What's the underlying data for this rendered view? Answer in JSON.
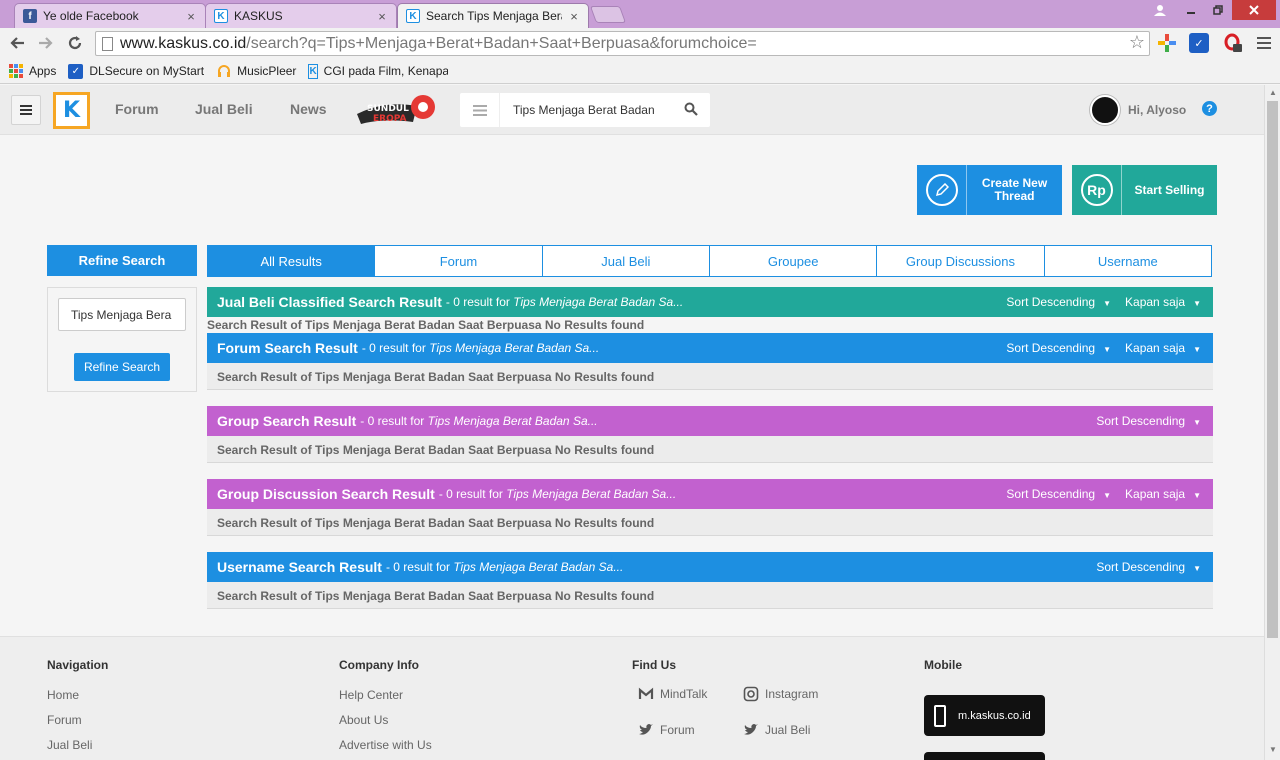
{
  "browser": {
    "tabs": [
      {
        "label": "Ye olde Facebook",
        "favicon": "facebook-icon"
      },
      {
        "label": "KASKUS",
        "favicon": "kaskus-icon"
      },
      {
        "label": "Search Tips Menjaga Bera",
        "favicon": "kaskus-icon",
        "active": true
      }
    ],
    "tab_close_glyph": "×",
    "url_host": "www.kaskus.co.id",
    "url_rest": "/search?q=Tips+Menjaga+Berat+Badan+Saat+Berpuasa&forumchoice=",
    "bookmarks": [
      {
        "label": "Apps",
        "icon": "apps-grid-icon"
      },
      {
        "label": "DLSecure on MyStart",
        "icon": "dlsecure-icon"
      },
      {
        "label": "MusicPleer",
        "icon": "headphones-icon"
      },
      {
        "label": "CGI pada Film, Kenapa",
        "icon": "kaskus-icon"
      }
    ],
    "accent_color": "#c89ed6"
  },
  "header": {
    "logo_glyph": "K",
    "nav": [
      "Forum",
      "Jual Beli",
      "News"
    ],
    "promo_text": [
      "SUNDUL",
      "EROPA"
    ],
    "search_value": "Tips Menjaga Berat Badan",
    "greeting": "Hi, Alyoso",
    "help_glyph": "?"
  },
  "actions": {
    "create_thread": "Create New Thread",
    "start_selling": "Start Selling",
    "rp_glyph": "Rp",
    "create_color": "#1d8fe1",
    "sell_color": "#21a89a"
  },
  "refine": {
    "header": "Refine Search",
    "input_value": "Tips Menjaga Bera",
    "button": "Refine Search"
  },
  "tabs": [
    "All Results",
    "Forum",
    "Jual Beli",
    "Groupee",
    "Group Discussions",
    "Username"
  ],
  "results": [
    {
      "title": "Jual Beli Classified Search Result",
      "summary_prefix": " - 0 result for ",
      "query": "Tips Menjaga Berat Badan Sa...",
      "sort": "Sort Descending",
      "time": "Kapan saja",
      "color": "#21a89a",
      "body": "Search Result of Tips Menjaga Berat Badan Saat Berpuasa No Results found"
    },
    {
      "title": "Forum Search Result",
      "summary_prefix": " - 0 result for ",
      "query": "Tips Menjaga Berat Badan Sa...",
      "sort": "Sort Descending",
      "time": "Kapan saja",
      "color": "#1d8fe1",
      "body": "Search Result of Tips Menjaga Berat Badan Saat Berpuasa No Results found"
    },
    {
      "title": "Group Search Result",
      "summary_prefix": " - 0 result for ",
      "query": "Tips Menjaga Berat Badan Sa...",
      "sort": "Sort Descending",
      "color": "#c261cf",
      "body": "Search Result of Tips Menjaga Berat Badan Saat Berpuasa No Results found"
    },
    {
      "title": "Group Discussion Search Result",
      "summary_prefix": " - 0 result for ",
      "query": "Tips Menjaga Berat Badan Sa...",
      "sort": "Sort Descending",
      "time": "Kapan saja",
      "color": "#c261cf",
      "body": "Search Result of Tips Menjaga Berat Badan Saat Berpuasa No Results found"
    },
    {
      "title": "Username Search Result",
      "summary_prefix": " - 0 result for ",
      "query": "Tips Menjaga Berat Badan Sa...",
      "sort": "Sort Descending",
      "color": "#1d8fe1",
      "body": "Search Result of Tips Menjaga Berat Badan Saat Berpuasa No Results found"
    }
  ],
  "footer": {
    "navigation": {
      "title": "Navigation",
      "links": [
        "Home",
        "Forum",
        "Jual Beli"
      ]
    },
    "company": {
      "title": "Company Info",
      "links": [
        "Help Center",
        "About Us",
        "Advertise with Us"
      ]
    },
    "find_us": {
      "title": "Find Us",
      "items": [
        {
          "label": "MindTalk",
          "icon": "mindtalk-icon"
        },
        {
          "label": "Instagram",
          "icon": "instagram-icon"
        },
        {
          "label": "Forum",
          "icon": "twitter-icon"
        },
        {
          "label": "Jual Beli",
          "icon": "twitter-icon"
        }
      ]
    },
    "mobile": {
      "title": "Mobile",
      "badge": "m.kaskus.co.id"
    }
  }
}
